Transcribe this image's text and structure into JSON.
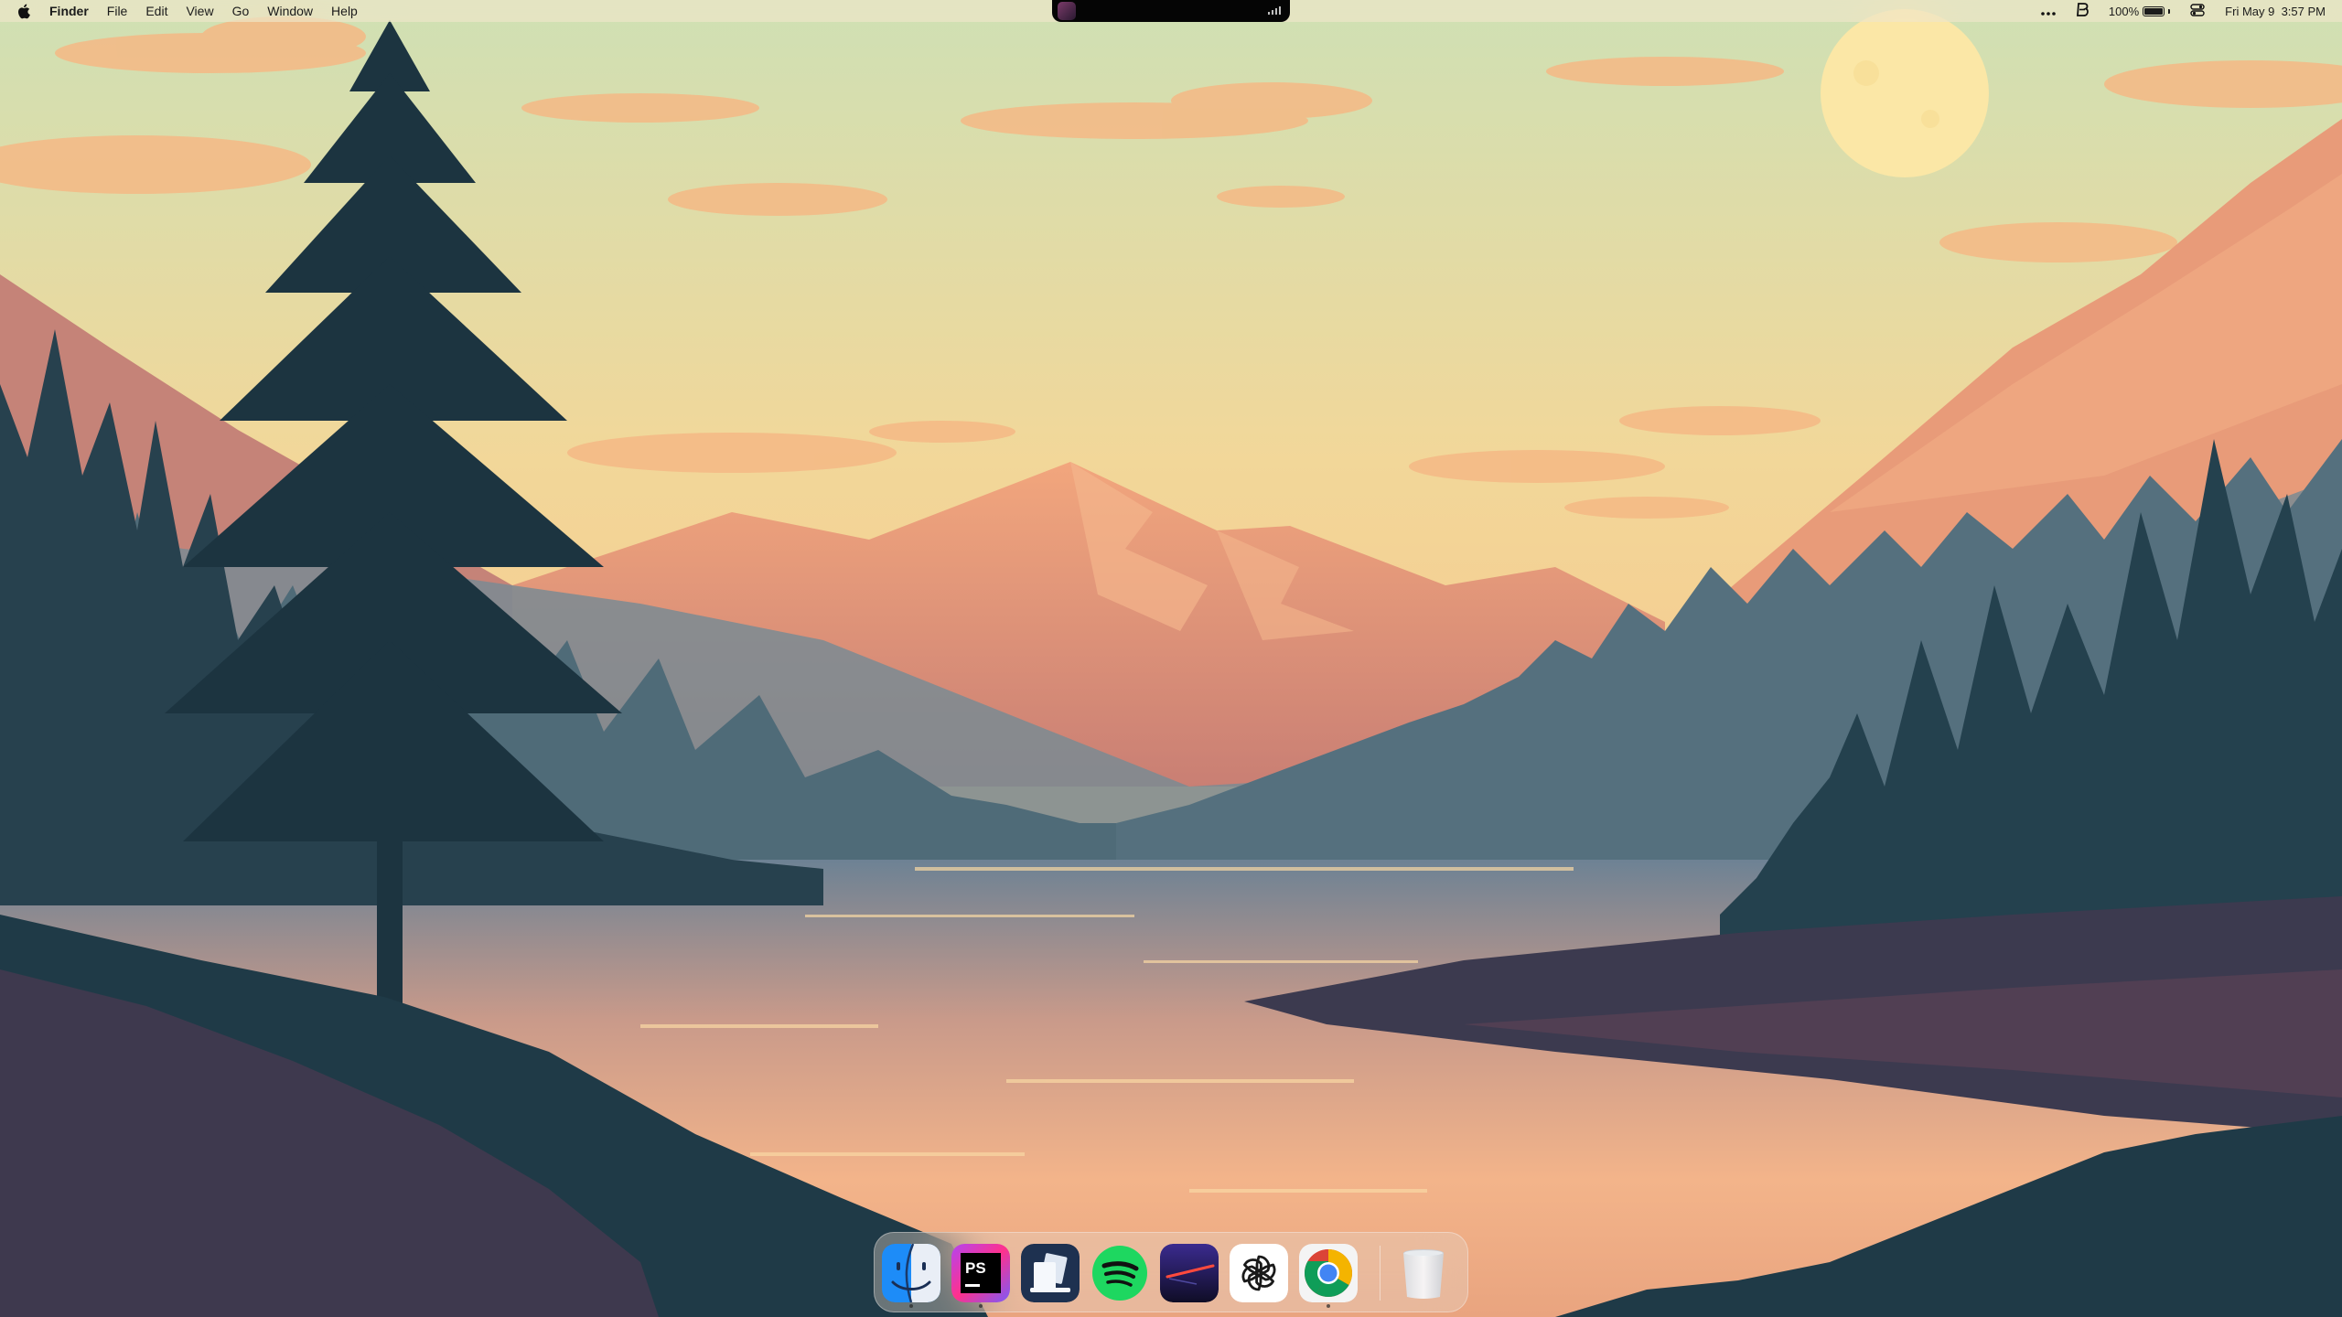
{
  "menubar": {
    "app_name": "Finder",
    "menus": [
      "File",
      "Edit",
      "View",
      "Go",
      "Window",
      "Help"
    ],
    "status": {
      "battery_percent_text": "100%",
      "battery_level": 1.0,
      "date": "Fri May 9",
      "time": "3:57 PM"
    },
    "icons": [
      "apple-logo-icon",
      "more-icon",
      "app-b-icon",
      "battery-icon",
      "control-center-icon"
    ]
  },
  "desktop": {
    "wallpaper": "sunset-mountain-lake-illustration",
    "colors": {
      "sky_top": "#d8e2b6",
      "sky_bottom": "#f6c98f",
      "sun": "#fbe7a6",
      "mountain_peach": "#e9a07c",
      "forest_far": "#5c7a86",
      "forest_near": "#1f3a47",
      "lake_glow": "#f3b98a"
    }
  },
  "dock": {
    "apps": [
      {
        "name": "Finder",
        "icon": "finder-icon",
        "running": true
      },
      {
        "name": "PhpStorm",
        "icon": "phpstorm-icon",
        "running": true
      },
      {
        "name": "Microsoft Remote Desktop",
        "icon": "remote-desktop-icon",
        "running": false
      },
      {
        "name": "Spotify",
        "icon": "spotify-icon",
        "running": false
      },
      {
        "name": "Linear",
        "icon": "linear-icon",
        "running": false
      },
      {
        "name": "ChatGPT",
        "icon": "chatgpt-icon",
        "running": false
      },
      {
        "name": "Google Chrome",
        "icon": "chrome-icon",
        "running": true
      }
    ],
    "trash": {
      "name": "Trash",
      "icon": "trash-icon"
    }
  }
}
